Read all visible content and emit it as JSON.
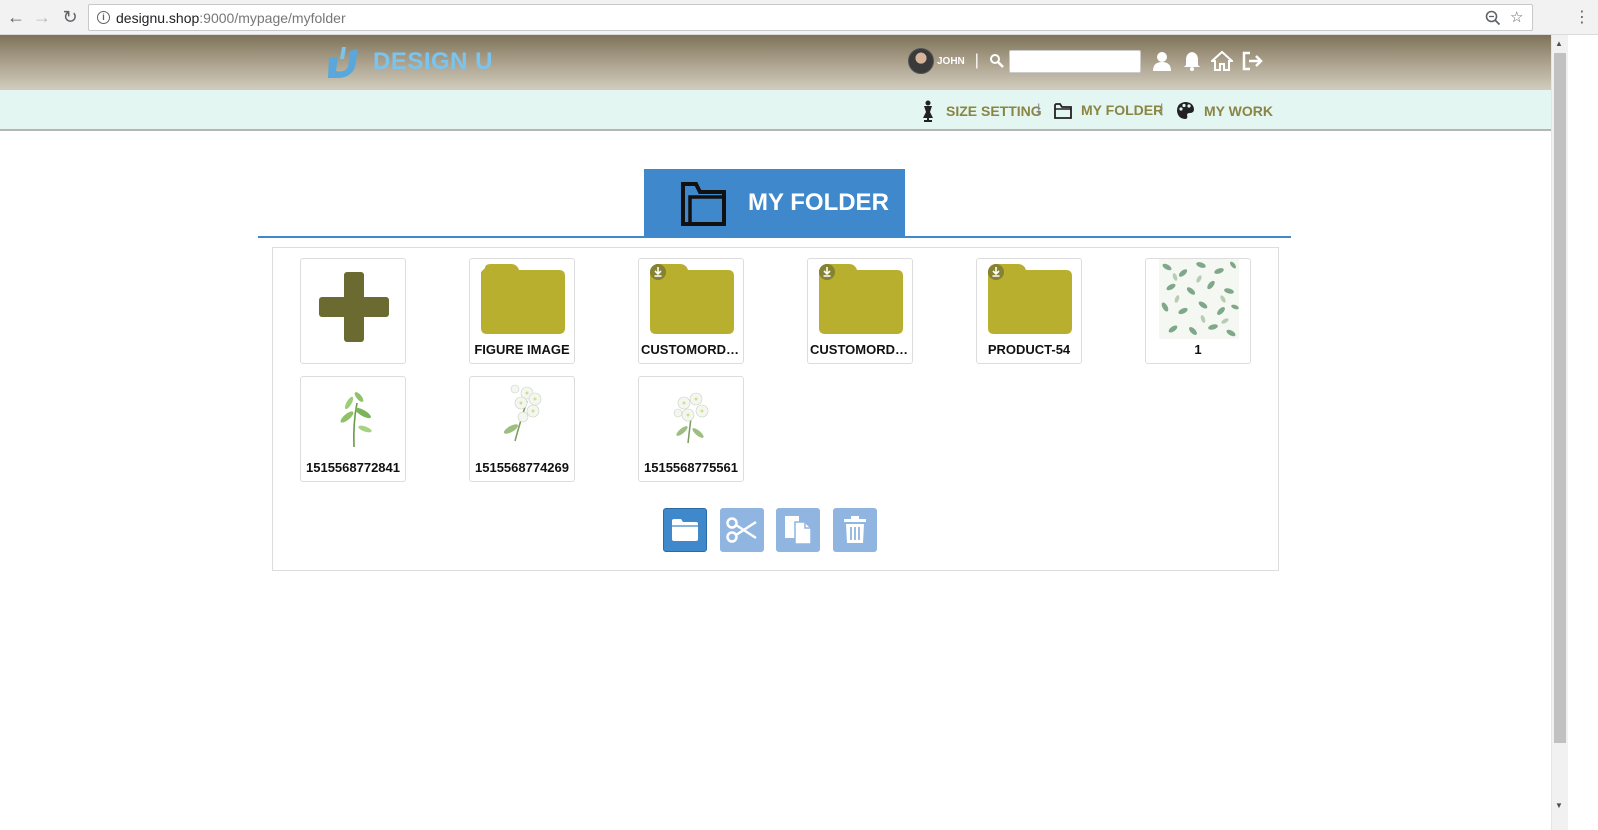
{
  "browser": {
    "url_host": "designu.shop",
    "url_path": ":9000/mypage/myfolder"
  },
  "header": {
    "logo_text": "DESIGN U",
    "user_name": "JOHN",
    "separator": "|",
    "search_placeholder": ""
  },
  "sub_nav": {
    "items": [
      {
        "label": "SIZE SETTING"
      },
      {
        "label": "MY FOLDER"
      },
      {
        "label": "MY WORK"
      }
    ],
    "separator": "|"
  },
  "page": {
    "title": "MY FOLDER"
  },
  "folder_items": [
    {
      "label": "",
      "type": "add"
    },
    {
      "label": "FIGURE IMAGE",
      "type": "folder"
    },
    {
      "label": "CUSTOMORDER",
      "type": "folder-shared"
    },
    {
      "label": "CUSTOMORDER",
      "type": "folder-shared"
    },
    {
      "label": "PRODUCT-54",
      "type": "folder-shared"
    },
    {
      "label": "1",
      "type": "image-pattern"
    },
    {
      "label": "1515568772841",
      "type": "image-sprig"
    },
    {
      "label": "1515568774269",
      "type": "image-flowers"
    },
    {
      "label": "1515568775561",
      "type": "image-flowers"
    }
  ],
  "colors": {
    "accent_blue": "#3f88cb",
    "folder_olive": "#b9af2f",
    "nav_text": "#8a8544",
    "logo_blue": "#7ac4ee"
  },
  "actions": [
    {
      "icon": "folder-icon"
    },
    {
      "icon": "scissors-icon"
    },
    {
      "icon": "copy-icon"
    },
    {
      "icon": "trash-icon"
    }
  ]
}
